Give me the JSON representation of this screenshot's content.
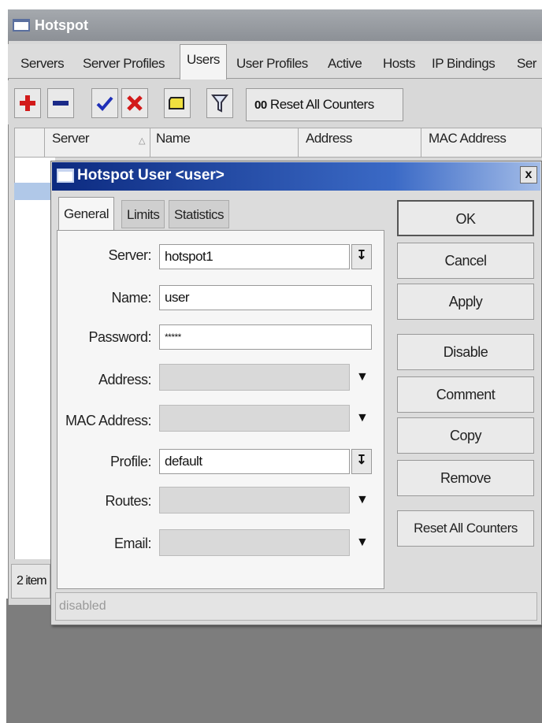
{
  "window": {
    "title": "Hotspot",
    "tabs": [
      "Servers",
      "Server Profiles",
      "Users",
      "User Profiles",
      "Active",
      "Hosts",
      "IP Bindings",
      "Ser"
    ],
    "active_tab": "Users",
    "toolbar": {
      "add_icon": "plus-icon",
      "remove_icon": "minus-icon",
      "enable_icon": "check-icon",
      "disable_icon": "x-icon",
      "comment_icon": "note-icon",
      "filter_icon": "filter-icon",
      "reset_label": "Reset All Counters",
      "reset_prefix": "00"
    },
    "columns": [
      "Server",
      "Name",
      "Address",
      "MAC Address"
    ],
    "item_count": "2 item"
  },
  "dialog": {
    "title": "Hotspot User <user>",
    "close": "x",
    "tabs": [
      "General",
      "Limits",
      "Statistics"
    ],
    "fields": {
      "server": {
        "label": "Server:",
        "value": "hotspot1"
      },
      "name": {
        "label": "Name:",
        "value": "user"
      },
      "password": {
        "label": "Password:",
        "value": "*****"
      },
      "address": {
        "label": "Address:",
        "value": ""
      },
      "mac": {
        "label": "MAC Address:",
        "value": ""
      },
      "profile": {
        "label": "Profile:",
        "value": "default"
      },
      "routes": {
        "label": "Routes:",
        "value": ""
      },
      "email": {
        "label": "Email:",
        "value": ""
      }
    },
    "buttons": {
      "ok": "OK",
      "cancel": "Cancel",
      "apply": "Apply",
      "disable": "Disable",
      "comment": "Comment",
      "copy": "Copy",
      "remove": "Remove",
      "reset": "Reset All Counters"
    },
    "status": "disabled"
  },
  "colors": {
    "dialog_title_start": "#0c2a80",
    "dialog_title_end": "#3b6ac6",
    "add_red": "#d21a1a",
    "remove_navy": "#1a2a88",
    "check_blue": "#1f2fb8"
  }
}
